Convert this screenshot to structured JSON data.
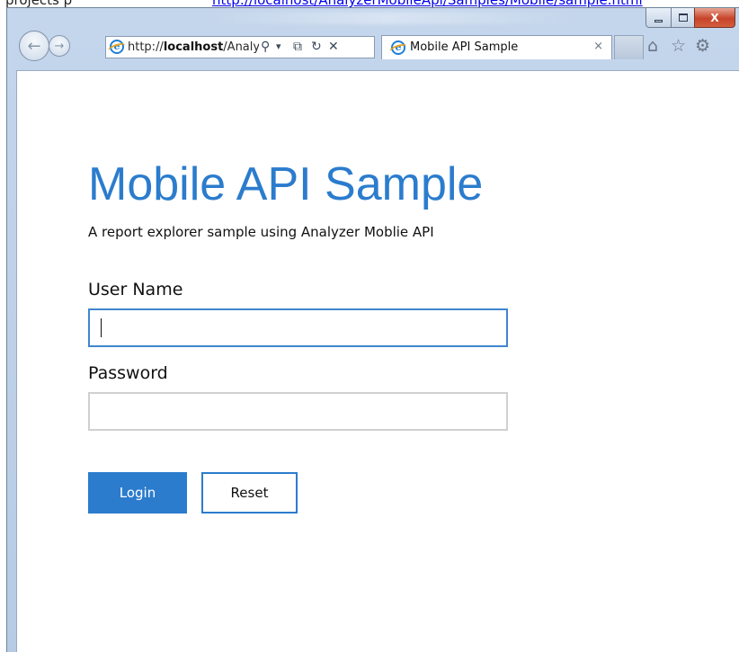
{
  "top_strip": {
    "text": "projects p",
    "link": "http://localhost/AnalyzerMobileApi/Samples/Mobile/sample.html"
  },
  "browser": {
    "window_controls": {
      "close_glyph": "X"
    },
    "nav": {
      "back_glyph": "←",
      "forward_glyph": "→"
    },
    "address": {
      "url_prefix": "http://",
      "url_host": "localhost",
      "url_rest": "/AnalyzerMobileApi/Samples/Mobile/sample.html",
      "search_glyph": "⚲",
      "dropdown_glyph": "▾",
      "compat_glyph": "⧉",
      "refresh_glyph": "↻",
      "stop_glyph": "✕"
    },
    "tab": {
      "title": "Mobile API Sample",
      "close_glyph": "×"
    },
    "toolbar": {
      "home_glyph": "⌂",
      "favorites_glyph": "☆",
      "tools_glyph": "⚙"
    },
    "icons": {
      "ie_logo": "e"
    }
  },
  "page": {
    "title": "Mobile API Sample",
    "subtitle": "A report explorer sample using Analyzer Moblie API",
    "username_label": "User Name",
    "username_value": "",
    "password_label": "Password",
    "password_value": "",
    "login_label": "Login",
    "reset_label": "Reset"
  },
  "colors": {
    "accent": "#2b7ccd",
    "focus_border": "#3f86cf",
    "input_border": "#d0d0d0",
    "close_button": "#c7442a"
  }
}
